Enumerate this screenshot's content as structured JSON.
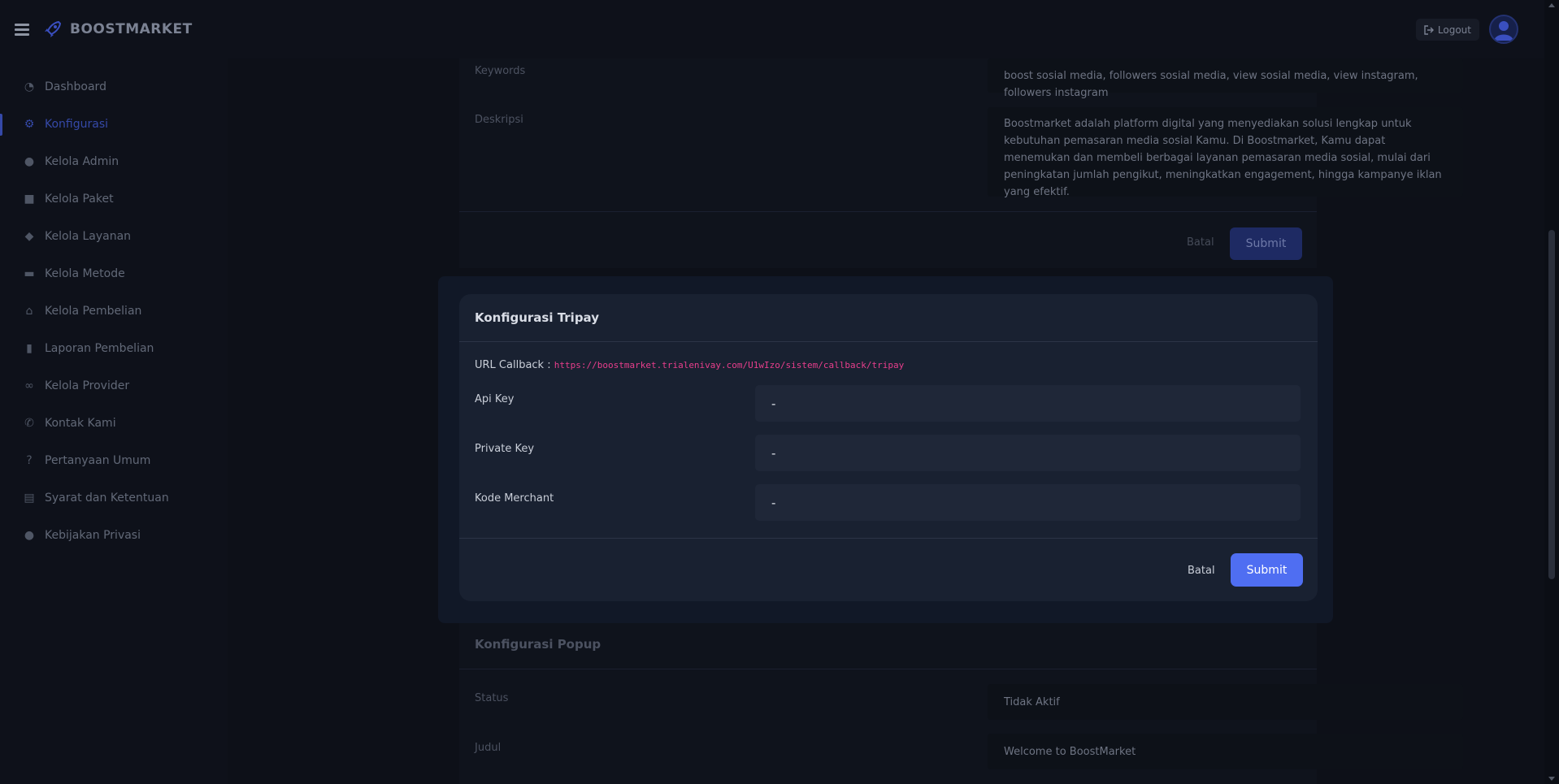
{
  "brand": {
    "name": "BOOSTMARKET"
  },
  "header": {
    "logout_label": "Logout"
  },
  "sidebar": {
    "items": [
      {
        "label": "Dashboard",
        "icon": "gauge-icon"
      },
      {
        "label": "Konfigurasi",
        "icon": "gears-icon",
        "active": true
      },
      {
        "label": "Kelola Admin",
        "icon": "user-gear-icon"
      },
      {
        "label": "Kelola Paket",
        "icon": "box-icon"
      },
      {
        "label": "Kelola Layanan",
        "icon": "tags-icon"
      },
      {
        "label": "Kelola Metode",
        "icon": "credit-card-icon"
      },
      {
        "label": "Kelola Pembelian",
        "icon": "basket-icon"
      },
      {
        "label": "Laporan Pembelian",
        "icon": "file-icon"
      },
      {
        "label": "Kelola Provider",
        "icon": "link-icon"
      },
      {
        "label": "Kontak Kami",
        "icon": "phone-icon"
      },
      {
        "label": "Pertanyaan Umum",
        "icon": "question-icon"
      },
      {
        "label": "Syarat dan Ketentuan",
        "icon": "file-contract-icon"
      },
      {
        "label": "Kebijakan Privasi",
        "icon": "user-shield-icon"
      }
    ]
  },
  "seo_card": {
    "keywords_label": "Keywords",
    "keywords_value": "boost sosial media, followers sosial media, view sosial media, view instagram, followers instagram",
    "deskripsi_label": "Deskripsi",
    "deskripsi_value": "Boostmarket adalah platform digital yang menyediakan solusi lengkap untuk kebutuhan pemasaran media sosial Kamu. Di Boostmarket, Kamu dapat menemukan dan membeli berbagai layanan pemasaran media sosial, mulai dari peningkatan jumlah pengikut, meningkatkan engagement, hingga kampanye iklan yang efektif.",
    "batal_label": "Batal",
    "submit_label": "Submit"
  },
  "popup_card": {
    "title": "Konfigurasi Popup",
    "status_label": "Status",
    "status_value": "Tidak Aktif",
    "judul_label": "Judul",
    "judul_value": "Welcome to BoostMarket"
  },
  "modal": {
    "title": "Konfigurasi Tripay",
    "callback_label": "URL Callback :",
    "callback_url": "https://boostmarket.trialenivay.com/U1wIzo/sistem/callback/tripay",
    "api_key_label": "Api Key",
    "api_key_value": "-",
    "private_key_label": "Private Key",
    "private_key_value": "-",
    "merchant_label": "Kode Merchant",
    "merchant_value": "-",
    "batal_label": "Batal",
    "submit_label": "Submit"
  },
  "colors": {
    "accent": "#4f6ef2",
    "callback": "#e83e8c",
    "background": "#131722"
  }
}
